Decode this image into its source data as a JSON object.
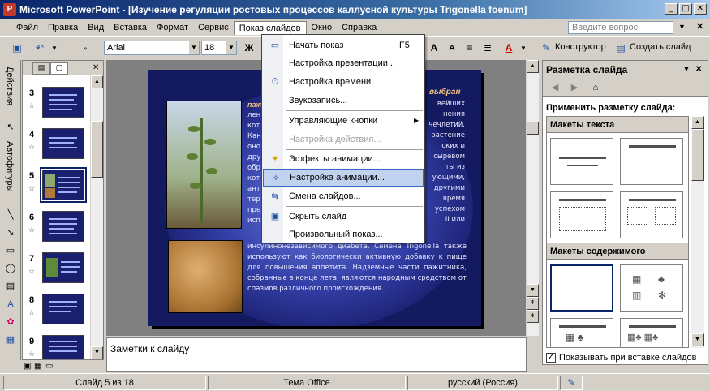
{
  "window": {
    "title": "Microsoft PowerPoint - [Изучение регуляции ростовых процессов каллусной культуры Trigonella foenum]",
    "minimize": "_",
    "maximize": "□",
    "close": "✕"
  },
  "menubar": {
    "items": [
      "Файл",
      "Правка",
      "Вид",
      "Вставка",
      "Формат",
      "Сервис",
      "Показ слайдов",
      "Окно",
      "Справка"
    ],
    "active_index": 6,
    "help_placeholder": "Введите вопрос"
  },
  "toolbar": {
    "font_name": "Arial",
    "font_size": "18",
    "bold_label": "Ж",
    "designer_label": "Конструктор",
    "new_slide_label": "Создать слайд"
  },
  "drawbar": {
    "actions_label": "Действия",
    "autoshapes_label": "Автофигуры"
  },
  "slides_pane": {
    "thumbnails": [
      {
        "number": "3"
      },
      {
        "number": "4"
      },
      {
        "number": "5",
        "selected": true
      },
      {
        "number": "6"
      },
      {
        "number": "7"
      },
      {
        "number": "8"
      },
      {
        "number": "9"
      }
    ]
  },
  "slide": {
    "title_fragment": "выбран",
    "word_fragment": "пажи",
    "right_lines": [
      "вейших",
      "нения",
      "чечлетий.",
      "растение",
      "ских и",
      "сыревом",
      "ты из",
      "ующими,",
      "другими",
      "время",
      "успехом",
      "II или"
    ],
    "left_lines": [
      "лен",
      "кот",
      "Кан",
      "оно",
      "дру",
      "обр",
      "кот",
      "ант",
      "тер",
      "пре",
      "исп"
    ],
    "body_bottom": "инсулинонезависимого диабета. Семена Trigonella также используют как биологически активную добавку к пище для повышения аппетита. Надземные части пажитника, собранные в конце лета, являются народным средством от спазмов различного происхождения."
  },
  "notes": {
    "placeholder": "Заметки к слайду"
  },
  "dropdown": {
    "items": [
      {
        "label": "Начать показ",
        "shortcut": "F5",
        "icon": "slideshow-icon"
      },
      {
        "label": "Настройка презентации...",
        "icon": ""
      },
      {
        "label": "Настройка времени",
        "icon": "timing-icon"
      },
      {
        "label": "Звукозапись...",
        "icon": ""
      },
      {
        "label": "Управляющие кнопки",
        "submenu": true,
        "icon": ""
      },
      {
        "label": "Настройка действия...",
        "disabled": true,
        "icon": ""
      },
      {
        "label": "Эффекты анимации...",
        "icon": "animation-effects-icon"
      },
      {
        "label": "Настройка анимации...",
        "highlighted": true,
        "icon": "custom-animation-icon"
      },
      {
        "label": "Смена слайдов...",
        "icon": "transition-icon"
      },
      {
        "label": "Скрыть слайд",
        "icon": "hide-slide-icon"
      },
      {
        "label": "Произвольный показ...",
        "icon": ""
      }
    ]
  },
  "task_pane": {
    "title": "Разметка слайда",
    "apply_label": "Применить разметку слайда:",
    "section_text": "Макеты текста",
    "section_content": "Макеты содержимого",
    "show_on_insert": "Показывать при вставке слайдов",
    "show_on_insert_checked": true
  },
  "statusbar": {
    "slide_info": "Слайд 5 из 18",
    "theme": "Тема Office",
    "language": "русский (Россия)"
  },
  "colors": {
    "titlebar": "#0a246a",
    "slide_background": "#1a1f6e",
    "menu_highlight": "#c1d2ee"
  }
}
